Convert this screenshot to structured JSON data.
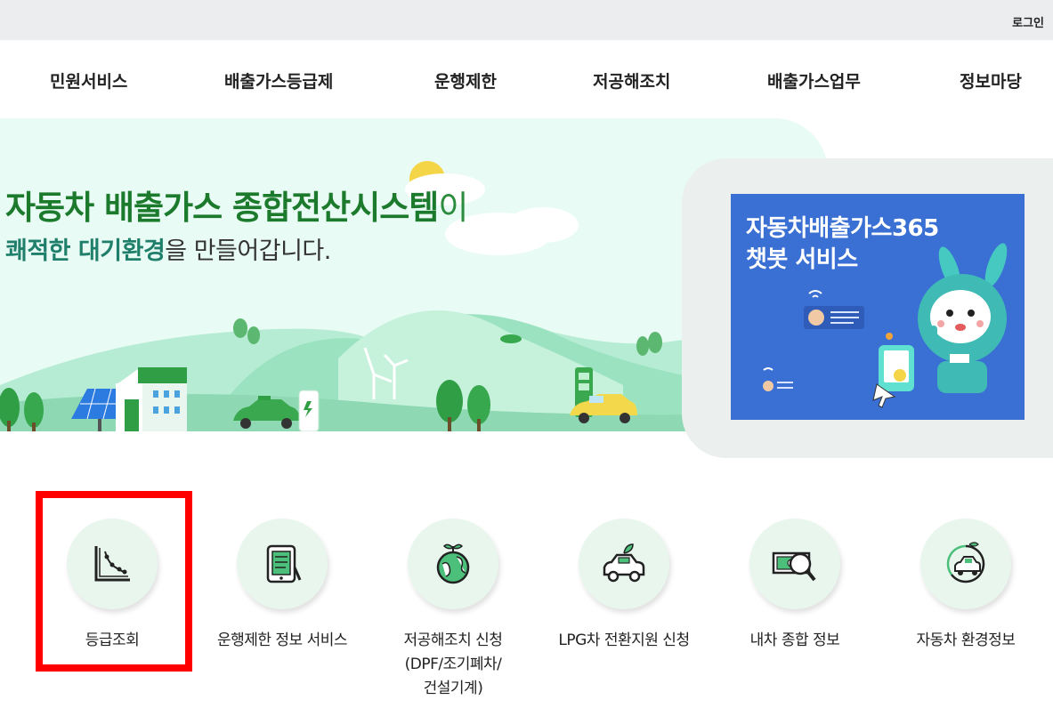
{
  "header": {
    "login_label": "로그인"
  },
  "nav": {
    "items": [
      {
        "label": "민원서비스"
      },
      {
        "label": "배출가스등급제"
      },
      {
        "label": "운행제한"
      },
      {
        "label": "저공해조치"
      },
      {
        "label": "배출가스업무"
      },
      {
        "label": "정보마당"
      }
    ]
  },
  "hero": {
    "title_main": "자동차 배출가스 종합전산시스템",
    "title_suffix": "이",
    "subtitle_highlight": "쾌적한 대기환경",
    "subtitle_rest": "을 만들어갑니다."
  },
  "banner": {
    "title_line1": "자동차배출가스365",
    "title_line2": "챗봇 서비스"
  },
  "services": [
    {
      "label": "등급조회",
      "icon": "chart-curve-icon"
    },
    {
      "label": "운행제한 정보 서비스",
      "icon": "tablet-document-icon"
    },
    {
      "label_line1": "저공해조치 신청",
      "label_line2": "(DPF/조기폐차/",
      "label_line3": "건설기계)",
      "icon": "earth-sprout-icon"
    },
    {
      "label": "LPG차 전환지원 신청",
      "icon": "eco-car-icon"
    },
    {
      "label": "내차 종합 정보",
      "icon": "money-search-icon"
    },
    {
      "label": "자동차 환경정보",
      "icon": "eco-vehicle-icon"
    }
  ],
  "colors": {
    "hero_green": "#1c7a2d",
    "banner_blue": "#3a6fd3",
    "service_circle": "#e8f6ee",
    "highlight_red": "#ff0000"
  }
}
